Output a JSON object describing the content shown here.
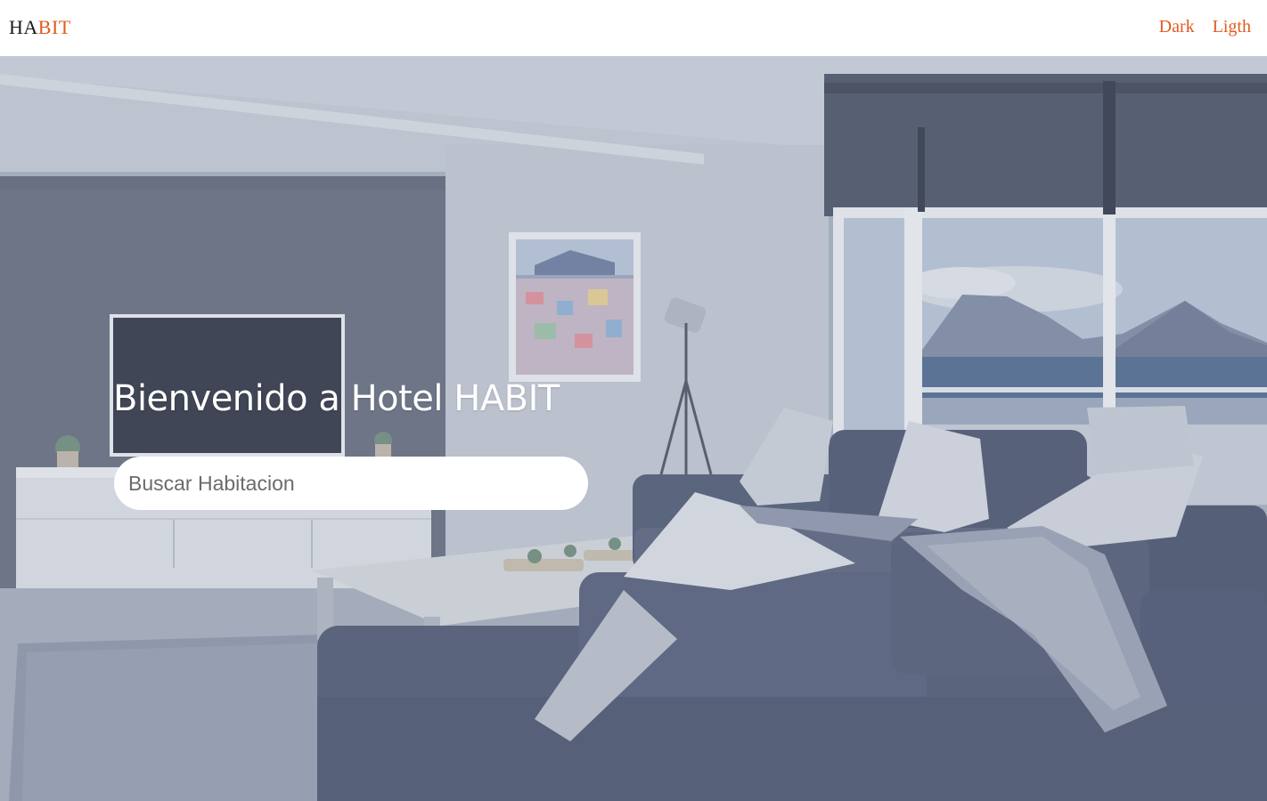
{
  "header": {
    "logo_part1": "HA",
    "logo_part2": "BIT",
    "theme_links": {
      "dark": "Dark",
      "light": "Ligth"
    }
  },
  "hero": {
    "title": "Bienvenido a Hotel HABIT",
    "search": {
      "placeholder": "Buscar Habitacion",
      "value": ""
    }
  },
  "colors": {
    "accent": "#e25a1f",
    "logo_dark": "#1b1b1b",
    "header_bg": "#ffffff"
  }
}
